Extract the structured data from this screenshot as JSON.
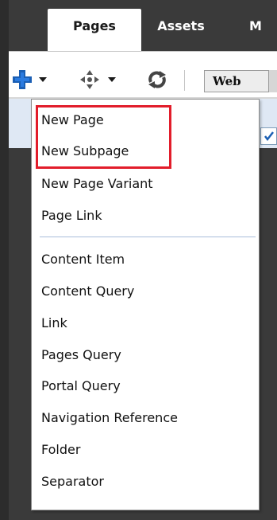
{
  "tabs": [
    {
      "label": "Pages",
      "active": true
    },
    {
      "label": "Assets",
      "active": false
    },
    {
      "label": "M",
      "active": false
    }
  ],
  "toolbar": {
    "add_icon": "plus-icon",
    "move_icon": "move-arrows-icon",
    "sync_icon": "refresh-icon",
    "web_select_value": "Web"
  },
  "menu": {
    "items": [
      {
        "label": "New Page"
      },
      {
        "label": "New Subpage"
      },
      {
        "label": "New Page Variant"
      },
      {
        "label": "Page Link"
      },
      {
        "label": "Content Item"
      },
      {
        "label": "Content Query"
      },
      {
        "label": "Link"
      },
      {
        "label": "Pages Query"
      },
      {
        "label": "Portal Query"
      },
      {
        "label": "Navigation Reference"
      },
      {
        "label": "Folder"
      },
      {
        "label": "Separator"
      }
    ],
    "highlight_color": "#e21d2b"
  },
  "colors": {
    "header_bg": "#3a3a3a",
    "accent_blue": "#1b5fb4",
    "menu_separator": "#a9bedb",
    "selection_band": "#dfe8f4"
  }
}
